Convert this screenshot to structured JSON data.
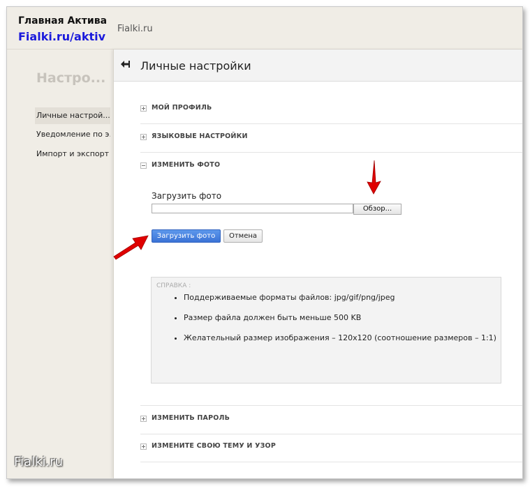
{
  "header": {
    "brand_title": "Главная Актива",
    "brand_link": "Fialki.ru/aktiv",
    "site_name": "Fialki.ru"
  },
  "sidebar": {
    "heading": "Настро...",
    "items": [
      {
        "label": "Личные настрой..."
      },
      {
        "label": "Уведомление по э..."
      },
      {
        "label": "Импорт и экспорт"
      }
    ]
  },
  "page": {
    "title": "Личные настройки"
  },
  "sections": {
    "profile": "МОЙ ПРОФИЛЬ",
    "language": "ЯЗЫКОВЫЕ НАСТРОЙКИ",
    "photo": "ИЗМЕНИТЬ ФОТО",
    "password": "ИЗМЕНИТЬ ПАРОЛЬ",
    "theme": "ИЗМЕНИТЕ СВОЮ ТЕМУ И УЗОР"
  },
  "photo_form": {
    "upload_label": "Загрузить фото",
    "browse_label": "Обзор...",
    "upload_button": "Загрузить фото",
    "cancel_button": "Отмена"
  },
  "help": {
    "title": "СПРАВКА :",
    "items": [
      "Поддерживаемые форматы файлов: jpg/gif/png/jpeg",
      "Размер файла должен быть меньше 500 KB",
      "Желательный размер изображения – 120x120 (соотношение размеров – 1:1)"
    ]
  },
  "watermark": "Fialki.ru",
  "colors": {
    "accent_blue": "#3b73d6",
    "brand_link": "#1a1adc",
    "annotation_arrow": "#e00000"
  }
}
